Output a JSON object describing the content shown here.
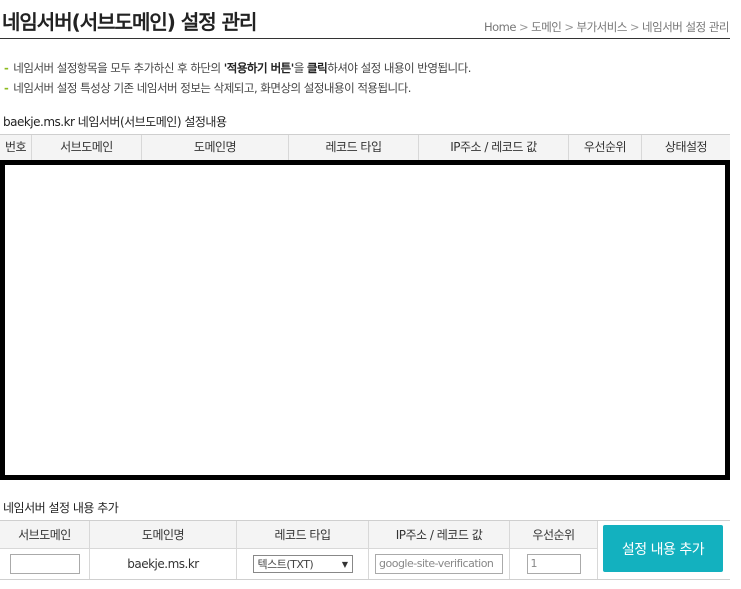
{
  "header": {
    "title": "네임서버(서브도메인) 설정 관리",
    "breadcrumb": [
      "Home",
      "도메인",
      "부가서비스",
      "네임서버 설정 관리"
    ]
  },
  "notes": [
    {
      "pre": "네임서버 설정항목을 모두 추가하신 후 하단의 ",
      "bold": "'적용하기 버튼'",
      "mid": "을 ",
      "bold2": "클릭",
      "post": "하셔야 설정 내용이 반영됩니다."
    },
    {
      "text": "네임서버 설정 특성상 기존 네임서버 정보는 삭제되고, 화면상의 설정내용이 적용됩니다."
    }
  ],
  "list": {
    "label": "baekje.ms.kr 네임서버(서브도메인) 설정내용",
    "columns": [
      "번호",
      "서브도메인",
      "도메인명",
      "레코드 타입",
      "IP주소 / 레코드 값",
      "우선순위",
      "상태설정"
    ]
  },
  "add": {
    "label": "네임서버 설정 내용 추가",
    "columns": [
      "서브도메인",
      "도메인명",
      "레코드 타입",
      "IP주소 / 레코드 값",
      "우선순위"
    ],
    "subdomain_value": "",
    "domain_name": "baekje.ms.kr",
    "record_type": "텍스트(TXT)",
    "record_value": "google-site-verification",
    "priority_value": "1",
    "button_label": "설정 내용 추가"
  }
}
